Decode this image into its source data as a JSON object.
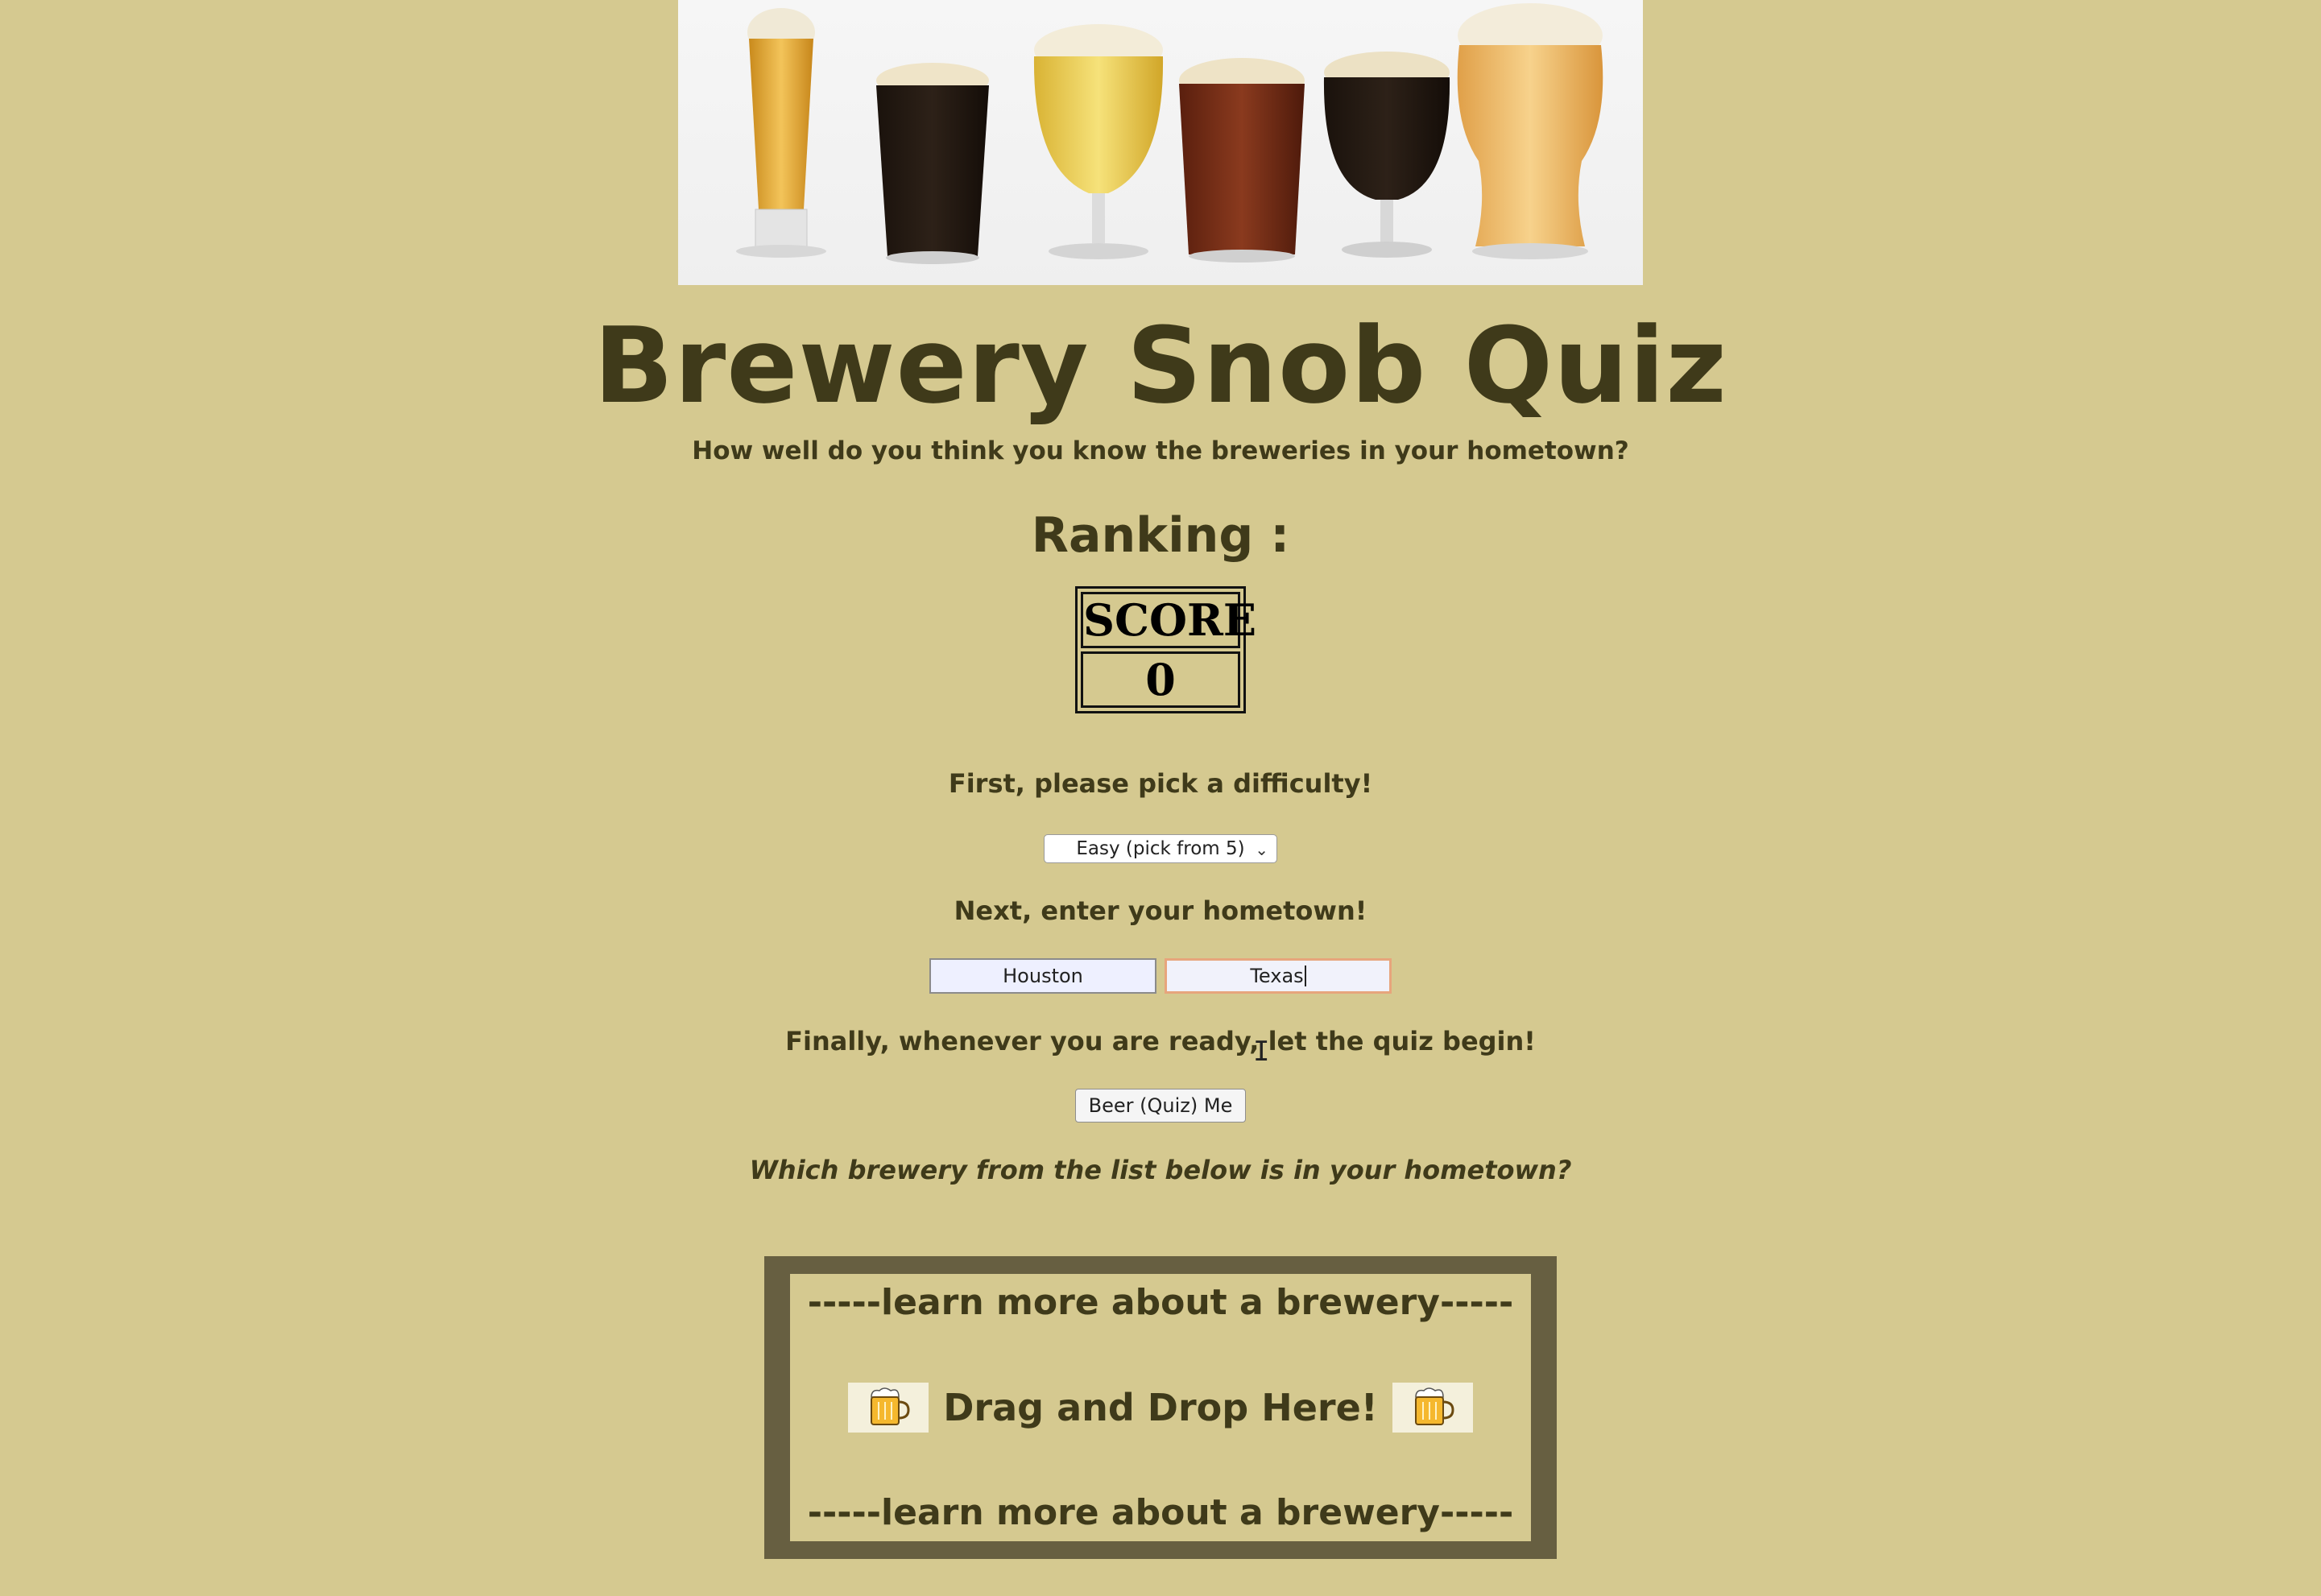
{
  "header": {
    "title": "Brewery Snob Quiz",
    "subtitle": "How well do you think you know the breweries in your hometown?"
  },
  "ranking": {
    "label": "Ranking :"
  },
  "score": {
    "label": "SCORE",
    "value": "0"
  },
  "steps": {
    "difficulty_prompt": "First, please pick a difficulty!",
    "difficulty_selected": "Easy (pick from 5)",
    "hometown_prompt": "Next, enter your hometown!",
    "city_value": "Houston",
    "state_value": "Texas",
    "begin_prompt": "Finally, whenever you are ready, let the quiz begin!",
    "begin_button": "Beer (Quiz) Me",
    "question": "Which brewery from the list below is in your hometown?"
  },
  "dropzone": {
    "top_text": "-----learn more about a brewery-----",
    "drop_text": "Drag and Drop Here!",
    "bottom_text": "-----learn more about a brewery-----"
  },
  "icons": {
    "hero": "beer-glasses-image",
    "mug_left": "beer-mug-icon",
    "mug_right": "beer-mug-icon",
    "dropdown": "chevron-down-icon"
  },
  "colors": {
    "background": "#d5c990",
    "text": "#3f3a1a",
    "dropzone_border": "#675f41",
    "focus_ring": "#e7a57c"
  }
}
